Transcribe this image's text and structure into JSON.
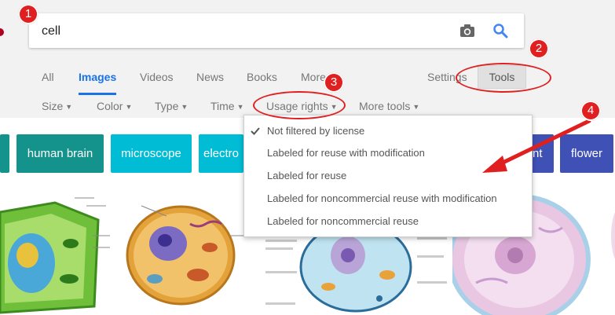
{
  "search": {
    "query": "cell"
  },
  "nav": {
    "tabs": [
      {
        "label": "All"
      },
      {
        "label": "Images"
      },
      {
        "label": "Videos"
      },
      {
        "label": "News"
      },
      {
        "label": "Books"
      },
      {
        "label": "More"
      }
    ],
    "active_tab": "Images",
    "settings_label": "Settings",
    "tools_label": "Tools"
  },
  "filters": [
    {
      "label": "Size"
    },
    {
      "label": "Color"
    },
    {
      "label": "Type"
    },
    {
      "label": "Time"
    },
    {
      "label": "Usage rights"
    },
    {
      "label": "More tools"
    }
  ],
  "chips": [
    {
      "label": ""
    },
    {
      "label": "human brain"
    },
    {
      "label": "microscope"
    },
    {
      "label": "electro"
    },
    {
      "label": "nt"
    },
    {
      "label": "flower"
    }
  ],
  "usage_rights_menu": {
    "options": [
      {
        "label": "Not filtered by license",
        "checked": true
      },
      {
        "label": "Labeled for reuse with modification"
      },
      {
        "label": "Labeled for reuse"
      },
      {
        "label": "Labeled for noncommercial reuse with modification"
      },
      {
        "label": "Labeled for noncommercial reuse"
      }
    ]
  },
  "annotations": [
    {
      "number": "1"
    },
    {
      "number": "2"
    },
    {
      "number": "3"
    },
    {
      "number": "4"
    }
  ],
  "colors": {
    "accent": "#1a73e8",
    "annotation": "#e02020",
    "chip_teal": "#13938b",
    "chip_cyan": "#00bcd4",
    "chip_blue": "#3f51b5"
  }
}
